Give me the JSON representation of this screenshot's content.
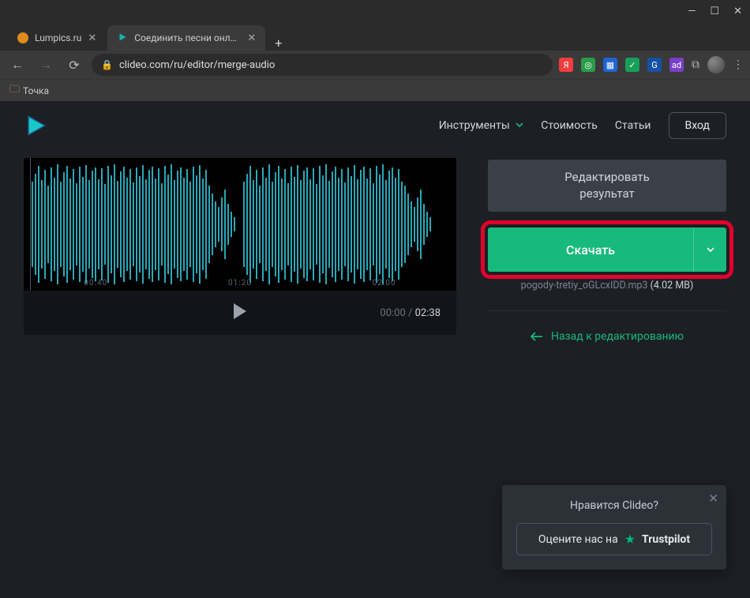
{
  "window": {
    "min": "—",
    "max": "☐",
    "close": "✕"
  },
  "tabs": [
    {
      "title": "Lumpics.ru",
      "favicon": "#e08a1e"
    },
    {
      "title": "Соединить песни онлайн — С...",
      "favicon": "clideo"
    }
  ],
  "toolbar": {
    "url": "clideo.com/ru/editor/merge-audio"
  },
  "bookmarks": {
    "item1": "Точка"
  },
  "nav": {
    "tools": "Инструменты",
    "pricing": "Стоимость",
    "articles": "Статьи",
    "login": "Вход"
  },
  "player": {
    "times": [
      "00:40",
      "01:20",
      "02:00"
    ],
    "current": "00:00",
    "duration": "02:38"
  },
  "panel": {
    "edit_line1": "Редактировать",
    "edit_line2": "результат",
    "download": "Скачать",
    "filename": "pogody-tretiy_oGLcxIDD.mp3",
    "filesize": "(4.02 MB)",
    "back": "Назад к редактированию"
  },
  "toast": {
    "title": "Нравится Clideo?",
    "cta_prefix": "Оцените нас на",
    "brand": "Trustpilot"
  }
}
